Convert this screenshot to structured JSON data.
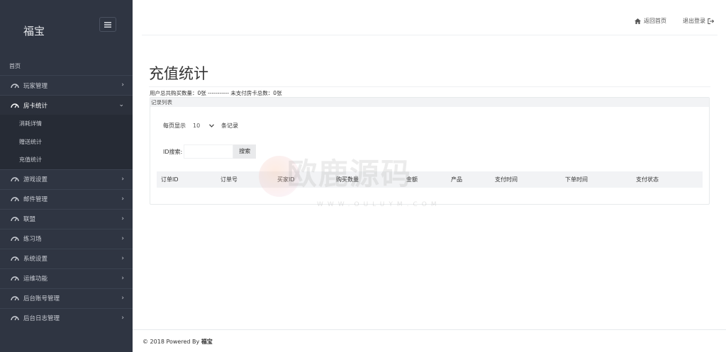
{
  "sidebar": {
    "brand": "福宝",
    "home": "首页",
    "items": [
      {
        "label": "玩家管理",
        "expanded": false
      },
      {
        "label": "房卡统计",
        "expanded": true
      },
      {
        "label": "游戏设置",
        "expanded": false
      },
      {
        "label": "邮件管理",
        "expanded": false
      },
      {
        "label": "联盟",
        "expanded": false
      },
      {
        "label": "练习场",
        "expanded": false
      },
      {
        "label": "系统设置",
        "expanded": false
      },
      {
        "label": "运维功能",
        "expanded": false
      },
      {
        "label": "后台账号管理",
        "expanded": false
      },
      {
        "label": "后台日志管理",
        "expanded": false
      }
    ],
    "subitems": [
      "消耗详情",
      "赠送统计",
      "充值统计"
    ]
  },
  "topbar": {
    "home_label": "返回首页",
    "logout_label": "退出登录"
  },
  "main": {
    "title": "充值统计",
    "summary": "用户总共购买数量：0张 ----------- 未支付房卡总数：0张",
    "card_title": "记录列表",
    "length_prefix": "每页显示",
    "length_value": "10",
    "length_suffix": "条记录",
    "search_label": "ID搜索:",
    "search_placeholder": "",
    "search_button": "搜索",
    "columns": [
      "订单ID",
      "订单号",
      "买家ID",
      "购买数量",
      "金额",
      "产品",
      "支付时间",
      "下单时间",
      "支付状态"
    ]
  },
  "watermark": {
    "text": "欧鹿源码",
    "sub": "WWW.OULUYM.COM"
  },
  "footer": {
    "prefix": "© 2018 Powered By",
    "brand": "福宝"
  },
  "colors": {
    "sidebar_bg": "#2f3542",
    "sidebar_text": "#c9ccd3",
    "header_bg": "#f2f3f5"
  }
}
